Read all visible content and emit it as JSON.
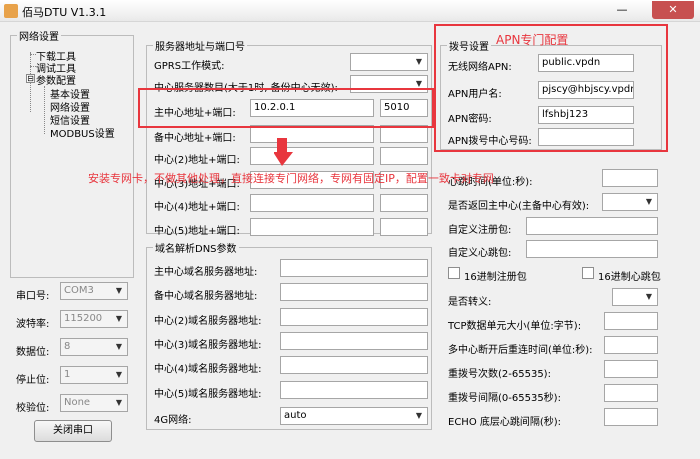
{
  "window": {
    "title": "佰马DTU V1.3.1",
    "close_glyph": "✕",
    "minimize_glyph": "—"
  },
  "nav": {
    "title": "网络设置",
    "items": [
      "下载工具",
      "调试工具",
      "参数配置",
      "基本设置",
      "网络设置",
      "短信设置",
      "MODBUS设置"
    ],
    "expander_glyph": "⊟"
  },
  "serial": {
    "port": {
      "label": "串口号:",
      "value": "COM3"
    },
    "baud": {
      "label": "波特率:",
      "value": "115200"
    },
    "databits": {
      "label": "数据位:",
      "value": "8"
    },
    "stopbits": {
      "label": "停止位:",
      "value": "1"
    },
    "parity": {
      "label": "校验位:",
      "value": "None"
    },
    "close_button": "关闭串口"
  },
  "server": {
    "group_title": "服务器地址与端口号",
    "gprs_mode_label": "GPRS工作模式:",
    "center_count_label": "中心服务器数目(大于1时, 备份中心无效):",
    "main_center": {
      "label": "主中心地址+端口:",
      "ip": "10.2.0.1",
      "port": "5010"
    },
    "backup_center_label": "备中心地址+端口:",
    "center2_label": "中心(2)地址+端口:",
    "center3_label": "中心(3)地址+端口:",
    "center4_label": "中心(4)地址+端口:",
    "center5_label": "中心(5)地址+端口:"
  },
  "dns": {
    "group_title": "域名解析DNS参数",
    "main_label": "主中心域名服务器地址:",
    "backup_label": "备中心域名服务器地址:",
    "c2_label": "中心(2)域名服务器地址:",
    "c3_label": "中心(3)域名服务器地址:",
    "c4_label": "中心(4)域名服务器地址:",
    "c5_label": "中心(5)域名服务器地址:",
    "net4g_label": "4G网络:",
    "net4g_value": "auto"
  },
  "apn": {
    "group_title": "拨号设置",
    "annotation": "APN专门配置",
    "apn_label": "无线网络APN:",
    "apn_value": "public.vpdn",
    "user_label": "APN用户名:",
    "user_value": "pjscy@hbjscy.vpdn.he",
    "password_label": "APN密码:",
    "password_value": "lfshbj123",
    "dial_label": "APN拨号中心号码:"
  },
  "right": {
    "heartbeat_label": "心跳时间(单位:秒):",
    "return_main_label": "是否返回主中心(主备中心有效):",
    "custom_reg_label": "自定义注册包:",
    "custom_hb_label": "自定义心跳包:",
    "hex_reg_label": "16进制注册包",
    "hex_hb_label": "16进制心跳包",
    "escape_label": "是否转义:",
    "tcp_unit_label": "TCP数据单元大小(单位:字节):",
    "reconnect_label": "多中心断开后重连时间(单位:秒):",
    "redial_count_label": "重拨号次数(2-65535):",
    "redial_interval_label": "重拨号间隔(0-65535秒):",
    "echo_label": "ECHO 底层心跳间隔(秒):"
  },
  "annotation_main": "安装专网卡，不做其他处理，直接连接专门网络，专网有固定IP，配置一致卡对专网",
  "colors": {
    "annotation_red": "#e8363e"
  }
}
